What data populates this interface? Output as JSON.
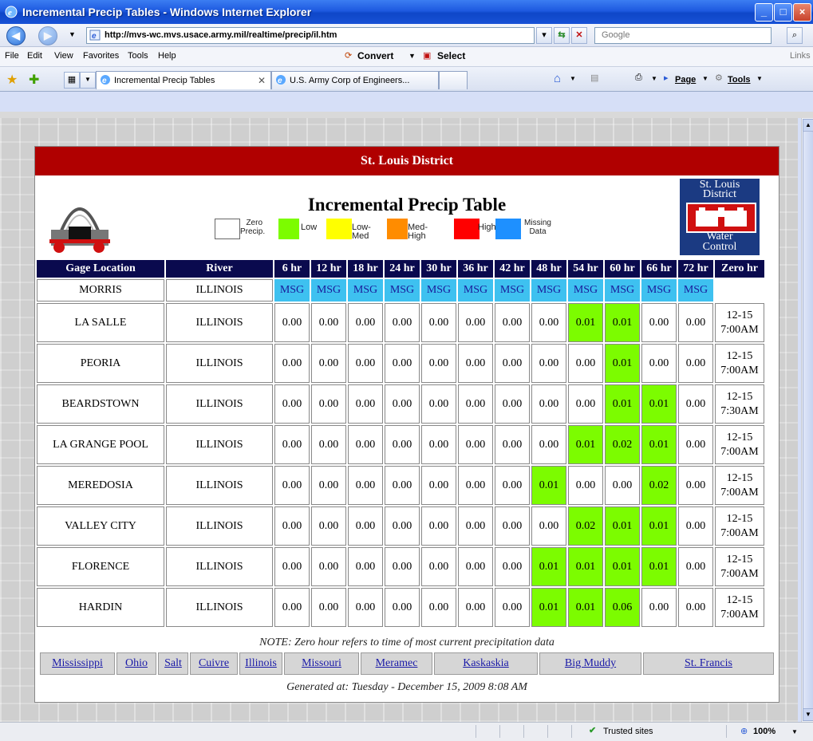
{
  "window": {
    "title": "Incremental Precip Tables - Windows Internet Explorer"
  },
  "address": {
    "url": "http://mvs-wc.mvs.usace.army.mil/realtime/precip/il.htm",
    "search_placeholder": "Google"
  },
  "menu": {
    "items": [
      "File",
      "Edit",
      "View",
      "Favorites",
      "Tools",
      "Help"
    ],
    "convert": "Convert",
    "select": "Select",
    "links": "Links"
  },
  "tabs": [
    {
      "label": "Incremental Precip Tables",
      "active": true
    },
    {
      "label": "U.S. Army Corp of Engineers...",
      "active": false
    }
  ],
  "commands": {
    "page": "Page",
    "tools": "Tools"
  },
  "page": {
    "district": "St. Louis District",
    "title": "Incremental Precip Table",
    "legend": [
      {
        "label": "Zero Precip.",
        "color": "#ffffff"
      },
      {
        "label": "Low",
        "color": "#7cfc00"
      },
      {
        "label": "Low-Med",
        "color": "#ffff00"
      },
      {
        "label": "Med-High",
        "color": "#ff8c00"
      },
      {
        "label": "High",
        "color": "#ff0000"
      },
      {
        "label": "Missing Data",
        "color": "#1e90ff"
      }
    ],
    "logo": {
      "line1": "St. Louis",
      "line2": "District",
      "line3": "Water",
      "line4": "Control"
    },
    "table": {
      "columns": [
        "Gage Location",
        "River",
        "6 hr",
        "12 hr",
        "18 hr",
        "24 hr",
        "30 hr",
        "36 hr",
        "42 hr",
        "48 hr",
        "54 hr",
        "60 hr",
        "66 hr",
        "72 hr",
        "Zero hr"
      ],
      "rows": [
        {
          "location": "MORRIS",
          "river": "ILLINOIS",
          "values": [
            "MSG",
            "MSG",
            "MSG",
            "MSG",
            "MSG",
            "MSG",
            "MSG",
            "MSG",
            "MSG",
            "MSG",
            "MSG",
            "MSG"
          ],
          "date": "",
          "time": ""
        },
        {
          "location": "LA SALLE",
          "river": "ILLINOIS",
          "values": [
            "0.00",
            "0.00",
            "0.00",
            "0.00",
            "0.00",
            "0.00",
            "0.00",
            "0.00",
            "0.01",
            "0.01",
            "0.00",
            "0.00"
          ],
          "date": "12-15",
          "time": "7:00AM"
        },
        {
          "location": "PEORIA",
          "river": "ILLINOIS",
          "values": [
            "0.00",
            "0.00",
            "0.00",
            "0.00",
            "0.00",
            "0.00",
            "0.00",
            "0.00",
            "0.00",
            "0.01",
            "0.00",
            "0.00"
          ],
          "date": "12-15",
          "time": "7:00AM"
        },
        {
          "location": "BEARDSTOWN",
          "river": "ILLINOIS",
          "values": [
            "0.00",
            "0.00",
            "0.00",
            "0.00",
            "0.00",
            "0.00",
            "0.00",
            "0.00",
            "0.00",
            "0.01",
            "0.01",
            "0.00"
          ],
          "date": "12-15",
          "time": "7:30AM"
        },
        {
          "location": "LA GRANGE POOL",
          "river": "ILLINOIS",
          "values": [
            "0.00",
            "0.00",
            "0.00",
            "0.00",
            "0.00",
            "0.00",
            "0.00",
            "0.00",
            "0.01",
            "0.02",
            "0.01",
            "0.00"
          ],
          "date": "12-15",
          "time": "7:00AM"
        },
        {
          "location": "MEREDOSIA",
          "river": "ILLINOIS",
          "values": [
            "0.00",
            "0.00",
            "0.00",
            "0.00",
            "0.00",
            "0.00",
            "0.00",
            "0.01",
            "0.00",
            "0.00",
            "0.02",
            "0.00"
          ],
          "date": "12-15",
          "time": "7:00AM"
        },
        {
          "location": "VALLEY CITY",
          "river": "ILLINOIS",
          "values": [
            "0.00",
            "0.00",
            "0.00",
            "0.00",
            "0.00",
            "0.00",
            "0.00",
            "0.00",
            "0.02",
            "0.01",
            "0.01",
            "0.00"
          ],
          "date": "12-15",
          "time": "7:00AM"
        },
        {
          "location": "FLORENCE",
          "river": "ILLINOIS",
          "values": [
            "0.00",
            "0.00",
            "0.00",
            "0.00",
            "0.00",
            "0.00",
            "0.00",
            "0.01",
            "0.01",
            "0.01",
            "0.01",
            "0.00"
          ],
          "date": "12-15",
          "time": "7:00AM"
        },
        {
          "location": "HARDIN",
          "river": "ILLINOIS",
          "values": [
            "0.00",
            "0.00",
            "0.00",
            "0.00",
            "0.00",
            "0.00",
            "0.00",
            "0.01",
            "0.01",
            "0.06",
            "0.00",
            "0.00"
          ],
          "date": "12-15",
          "time": "7:00AM"
        }
      ]
    },
    "note": "NOTE: Zero hour refers to time of most current precipitation data",
    "rivers": [
      "Mississippi",
      "Ohio",
      "Salt",
      "Cuivre",
      "Illinois",
      "Missouri",
      "Meramec",
      "Kaskaskia",
      "Big Muddy",
      "St. Francis"
    ],
    "generated": "Generated at:  Tuesday - December 15, 2009  8:08 AM"
  },
  "status": {
    "zone": "Trusted sites",
    "zoom": "100%"
  },
  "colors": {
    "district_bar": "#b00000",
    "header": "#0a0a4e",
    "missing": "#3ec1f0",
    "low": "#7cfc00"
  }
}
